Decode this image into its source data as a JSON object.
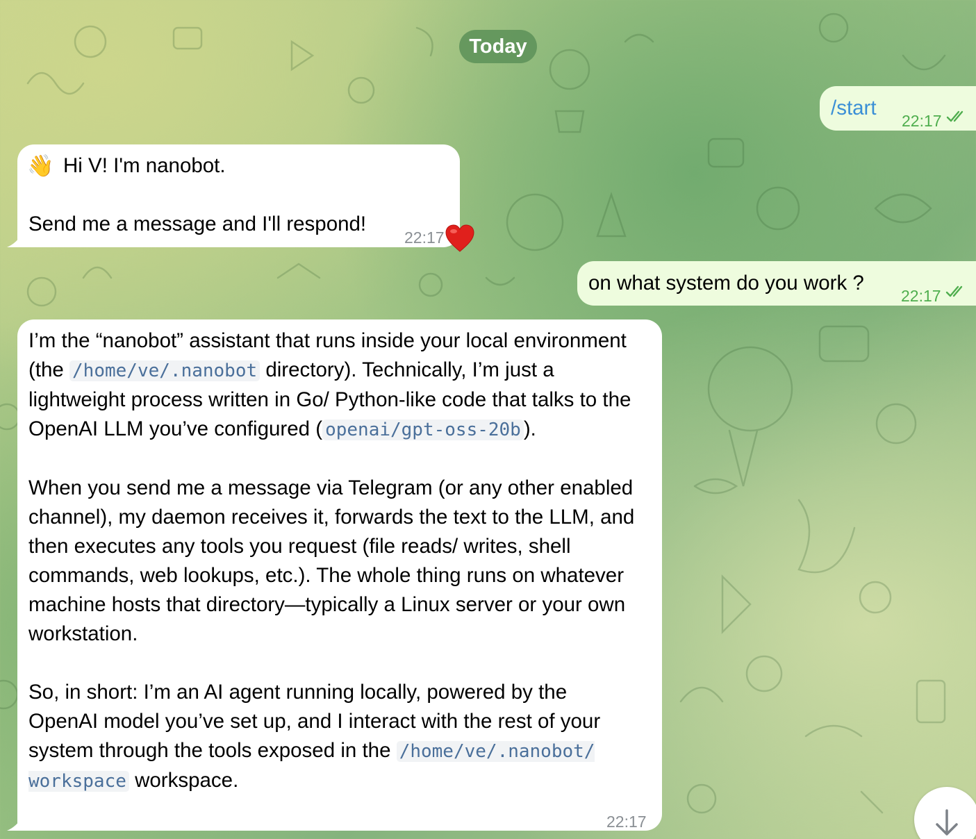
{
  "date_separator": "Today",
  "messages": [
    {
      "direction": "out",
      "text": "/start",
      "time": "22:17",
      "status": "read"
    },
    {
      "direction": "in",
      "emoji": "👋",
      "greeting": "Hi V! I'm nanobot.",
      "body": "Send me a message and I'll respond!",
      "time": "22:17",
      "reaction": "❤️"
    },
    {
      "direction": "out",
      "text": "on what system do you work ?",
      "time": "22:17",
      "status": "read"
    },
    {
      "direction": "in",
      "time": "22:17",
      "p1": {
        "t1": "I’m the “nanobot” assistant that runs inside your local environment (the ",
        "code1": "/home/ve/.nanobot",
        "t2": " directory). Technically, I’m just a lightweight process written in Go/ Python-like code that talks to the OpenAI LLM you’ve configured (",
        "code2": "openai/gpt-oss-20b",
        "t3": ")."
      },
      "p2": "When you send me a message via Telegram (or any other enabled channel), my daemon receives it, forwards the text to the LLM, and then executes any tools you request (file reads/ writes, shell commands, web lookups, etc.). The whole thing runs on whatever machine hosts that directory—typically a Linux server or your own workstation.",
      "p3": {
        "t1": "So, in short: I’m an AI agent running locally, powered by the OpenAI model you’ve set up, and I interact with the rest of your system through the tools exposed in the ",
        "code1": "/home/ve/.nanobot/ workspace",
        "t2": " workspace."
      }
    }
  ],
  "icons": {
    "read_receipt": "double-check-icon",
    "scroll_down": "arrow-down-icon",
    "reaction": "heart-icon"
  },
  "colors": {
    "outgoing_bubble": "#eefcde",
    "incoming_bubble": "#ffffff",
    "command_link": "#3a8fd6",
    "read_check": "#4fae4e",
    "date_pill": "#5c9158"
  }
}
